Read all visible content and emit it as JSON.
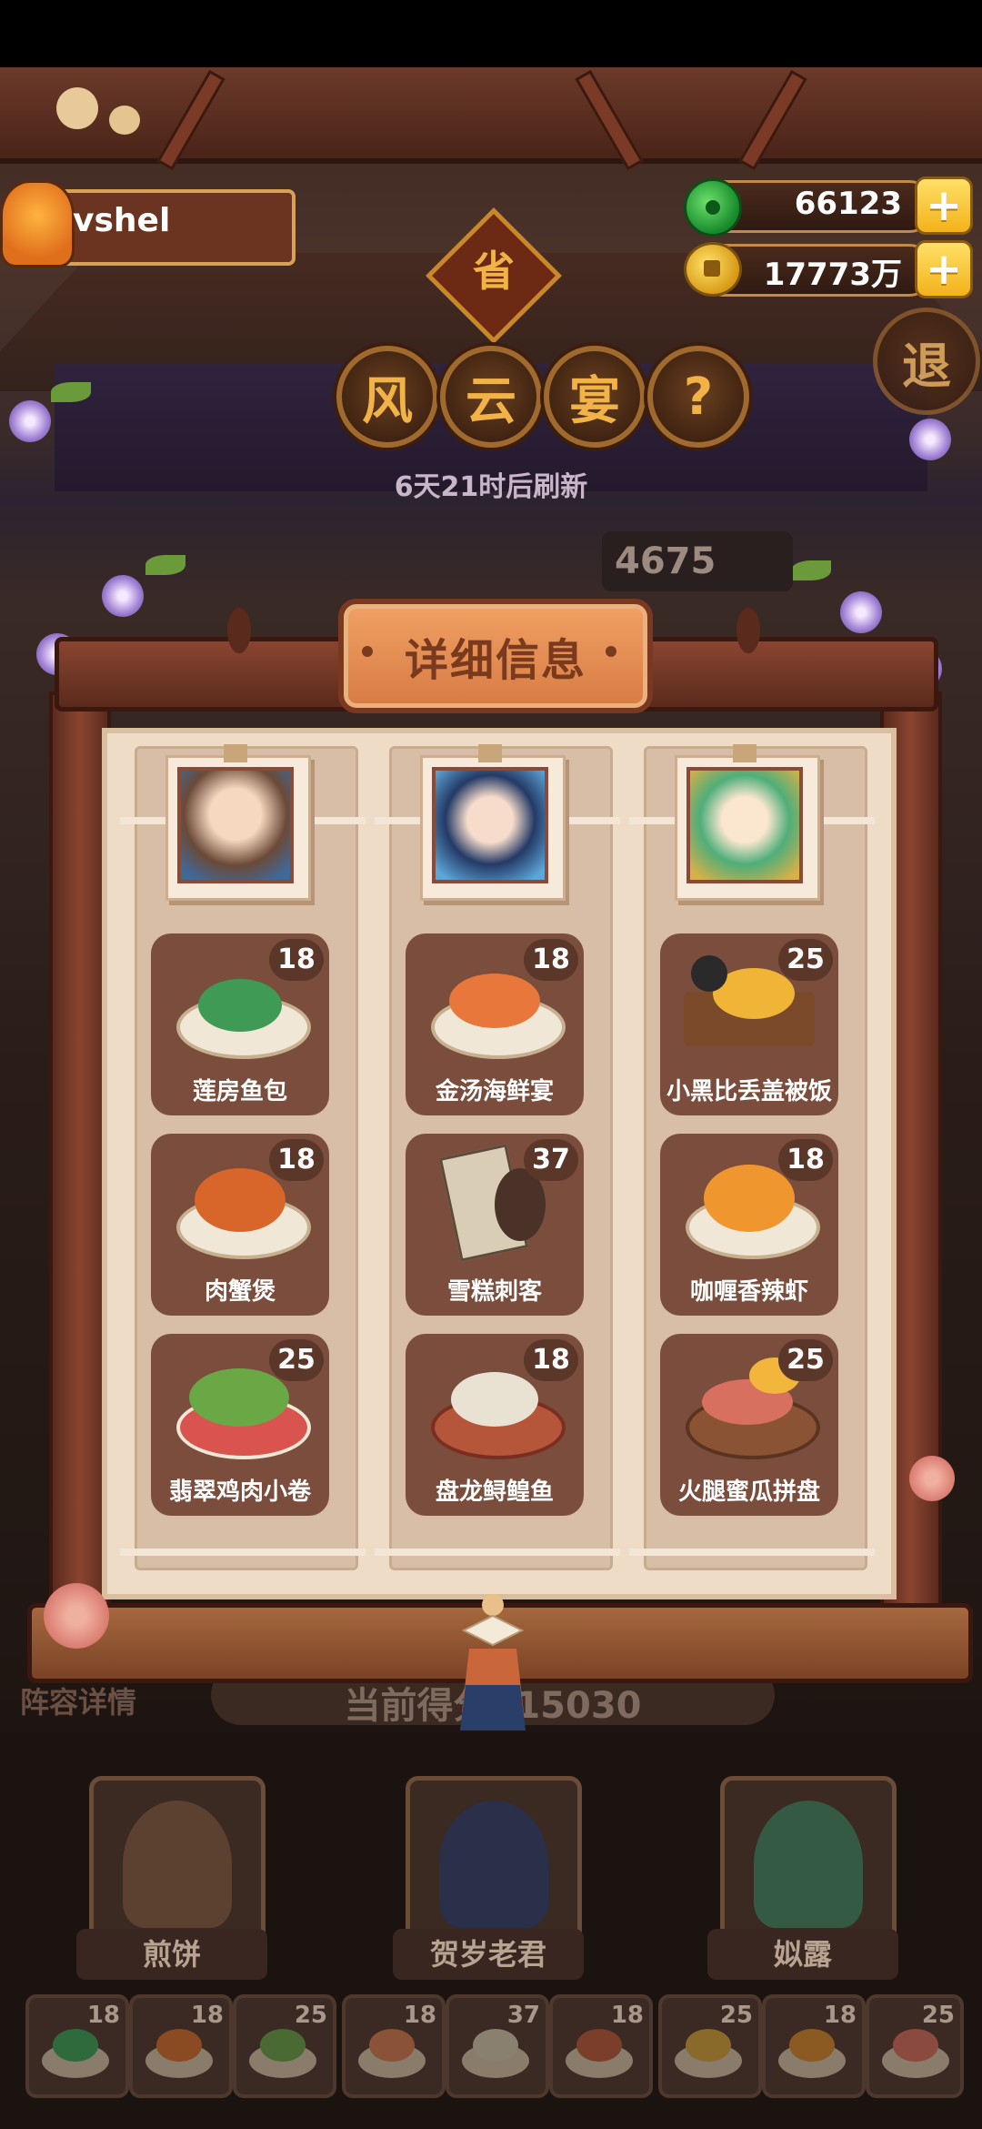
{
  "player": {
    "name": "vshel"
  },
  "currency": {
    "jade": "66123",
    "coins": "17773万"
  },
  "top_sign": "省",
  "title_chars": [
    "风",
    "云",
    "宴"
  ],
  "help_glyph": "?",
  "exit_label": "退",
  "refresh_text": "6天21时后刷新",
  "bg_score_partial": "4675",
  "panel": {
    "title": "详细信息",
    "columns": [
      {
        "character": "煎饼",
        "dishes": [
          {
            "name": "莲房鱼包",
            "level": "18",
            "color": "#3e9a54"
          },
          {
            "name": "肉蟹煲",
            "level": "18",
            "color": "#d8652a"
          },
          {
            "name": "翡翠鸡肉小卷",
            "level": "25",
            "color": "#6aa845"
          }
        ]
      },
      {
        "character": "贺岁老君",
        "dishes": [
          {
            "name": "金汤海鲜宴",
            "level": "18",
            "color": "#e7773a"
          },
          {
            "name": "雪糕刺客",
            "level": "37",
            "color": "#d9cdb5"
          },
          {
            "name": "盘龙鲟鳇鱼",
            "level": "18",
            "color": "#b5553a"
          }
        ]
      },
      {
        "character": "姒露",
        "dishes": [
          {
            "name": "小黑比丢盖被饭",
            "level": "25",
            "color": "#f0b437"
          },
          {
            "name": "咖喱香辣虾",
            "level": "18",
            "color": "#f0962e"
          },
          {
            "name": "火腿蜜瓜拼盘",
            "level": "25",
            "color": "#d7705e"
          }
        ]
      }
    ]
  },
  "team": {
    "label": "阵容详情",
    "score_text": "当前得分515030",
    "members": [
      "煎饼",
      "贺岁老君",
      "姒露"
    ],
    "mini_dishes": [
      "18",
      "18",
      "25",
      "18",
      "37",
      "18",
      "25",
      "18",
      "25"
    ]
  },
  "colors": {
    "accent": "#f1b247",
    "panel_paper": "#efdcc6",
    "dish_card": "#7a4d3c",
    "frame": "#8a4530"
  },
  "icons": {
    "jade": "jade-icon",
    "coin": "coin-icon",
    "plus": "plus-icon",
    "help": "help-icon"
  }
}
